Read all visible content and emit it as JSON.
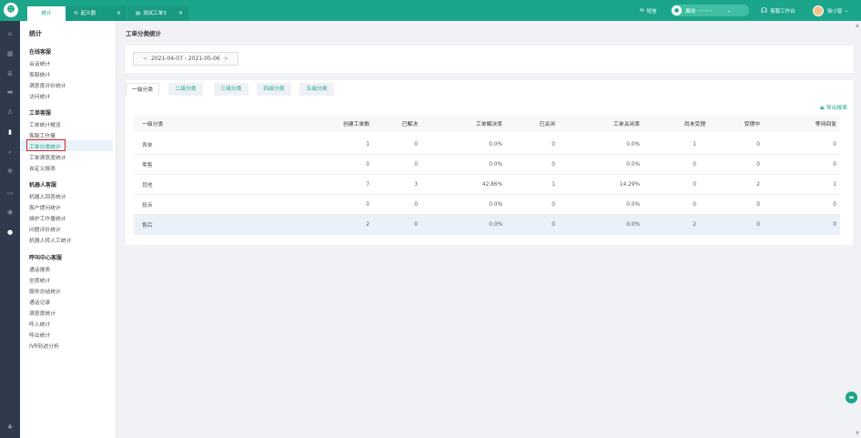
{
  "topbar": {
    "tabs": [
      {
        "label": "统计"
      },
      {
        "label": "起义器",
        "icon": "refresh-icon"
      },
      {
        "label": "测试工单3",
        "icon": "doc-icon"
      }
    ],
    "sms_label": "短信",
    "status_label": "离线",
    "status_time": "--:--:--",
    "workbench_label": "客服工作台",
    "user_name": "徐小智"
  },
  "sidebar_icons": [
    "home-icon",
    "grid-icon",
    "list-icon",
    "chat-icon",
    "user-icon",
    "chart-icon",
    "search-icon",
    "settings-icon",
    "message-icon",
    "app-icon",
    "info-icon",
    "bell-icon"
  ],
  "menu": {
    "title": "统计",
    "groups": [
      {
        "label": "在线客服",
        "items": [
          "会话统计",
          "客服统计",
          "满意度评价统计",
          "访问统计"
        ]
      },
      {
        "label": "工单客服",
        "items": [
          "工单统计概览",
          "客服工作量",
          "工单分类统计",
          "工单满意度统计",
          "自定义报表"
        ]
      },
      {
        "label": "机器人客服",
        "items": [
          "机器人回答统计",
          "客户提问统计",
          "维护工作量统计",
          "问题评价统计",
          "机器人转人工统计"
        ]
      },
      {
        "label": "呼叫中心客服",
        "items": [
          "通话报表",
          "坐席统计",
          "服务总结统计",
          "通话记录",
          "满意度统计",
          "呼入统计",
          "呼出统计",
          "IVR轨迹分析"
        ]
      }
    ],
    "selected_item": "工单分类统计"
  },
  "main": {
    "page_title": "工单分类统计",
    "date_range": "2021-04-07 - 2021-05-06",
    "category_tabs": [
      "一级分类",
      "二级分类",
      "三级分类",
      "四级分类",
      "五级分类"
    ],
    "active_tab": "一级分类",
    "export_label": "导出报表",
    "table": {
      "columns": [
        "一级分类",
        "创建工单数",
        "已解决",
        "工单解决率",
        "已关闭",
        "工单关闭率",
        "尚未受理",
        "受理中",
        "等待回复"
      ],
      "rows": [
        [
          "表单",
          "1",
          "0",
          "0.0%",
          "0",
          "0.0%",
          "1",
          "0",
          "0"
        ],
        [
          "零售",
          "0",
          "0",
          "0.0%",
          "0",
          "0.0%",
          "0",
          "0",
          "0"
        ],
        [
          "其他",
          "7",
          "3",
          "42.86%",
          "1",
          "14.29%",
          "0",
          "2",
          "1"
        ],
        [
          "投诉",
          "0",
          "0",
          "0.0%",
          "0",
          "0.0%",
          "0",
          "0",
          "0"
        ],
        [
          "售后",
          "2",
          "0",
          "0.0%",
          "0",
          "0.0%",
          "2",
          "0",
          "0"
        ]
      ]
    }
  },
  "colors": {
    "brand": "#1ba58a",
    "sidebar": "#2f3a4c",
    "highlight": "#e02020"
  }
}
